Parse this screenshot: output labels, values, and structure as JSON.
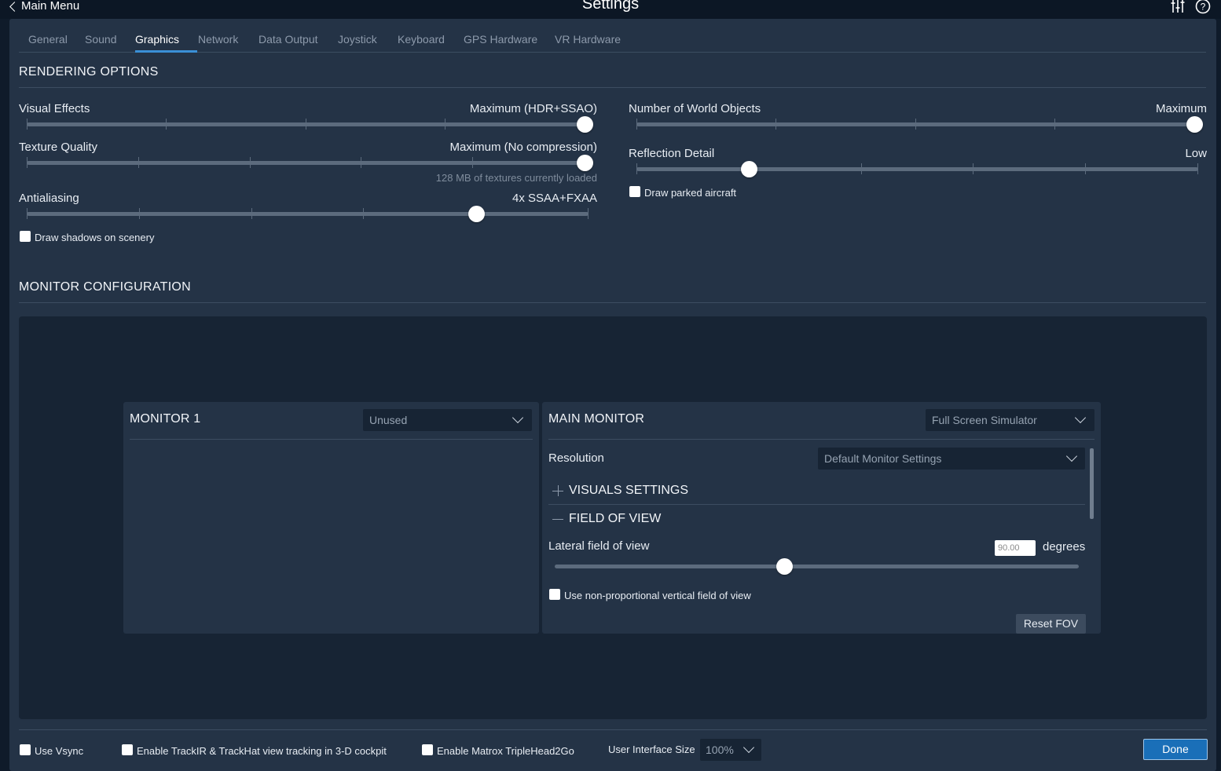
{
  "topbar": {
    "back_label": "Main Menu",
    "title": "Settings",
    "icons": [
      "sliders-icon",
      "help-icon"
    ]
  },
  "tabs": [
    {
      "label": "General"
    },
    {
      "label": "Sound"
    },
    {
      "label": "Graphics",
      "active": true
    },
    {
      "label": "Network"
    },
    {
      "label": "Data Output"
    },
    {
      "label": "Joystick"
    },
    {
      "label": "Keyboard"
    },
    {
      "label": "GPS Hardware"
    },
    {
      "label": "VR Hardware"
    }
  ],
  "rendering": {
    "title": "RENDERING OPTIONS",
    "visual_effects": {
      "label": "Visual Effects",
      "value": "Maximum (HDR+SSAO)",
      "level": 1.0,
      "steps": 5
    },
    "texture_quality": {
      "label": "Texture Quality",
      "value": "Maximum (No compression)",
      "level": 1.0,
      "steps": 6,
      "note": "128 MB of textures currently loaded"
    },
    "antialiasing": {
      "label": "Antialiasing",
      "value": "4x SSAA+FXAA",
      "level": 0.8,
      "steps": 6
    },
    "draw_shadows": {
      "label": "Draw shadows on scenery",
      "checked": false
    },
    "world_objects": {
      "label": "Number of World Objects",
      "value": "Maximum",
      "level": 1.0,
      "steps": 5
    },
    "reflection_detail": {
      "label": "Reflection Detail",
      "value": "Low",
      "level": 0.2,
      "steps": 6
    },
    "draw_parked": {
      "label": "Draw parked aircraft",
      "checked": false
    }
  },
  "monitor": {
    "title": "MONITOR CONFIGURATION",
    "monitor1": {
      "title": "MONITOR 1",
      "mode": "Unused"
    },
    "main": {
      "title": "MAIN MONITOR",
      "mode": "Full Screen Simulator",
      "resolution_label": "Resolution",
      "resolution_value": "Default Monitor Settings",
      "visuals_settings": "VISUALS SETTINGS",
      "field_of_view": "FIELD OF VIEW",
      "lateral_label": "Lateral field of view",
      "lateral_value": "90.00",
      "degrees": "degrees",
      "lateral_level": 0.4375,
      "nonprop_label": "Use non-proportional vertical field of view",
      "nonprop_checked": false,
      "reset_fov": "Reset FOV"
    }
  },
  "bottom": {
    "vsync": "Use Vsync",
    "trackir": "Enable TrackIR & TrackHat view tracking in 3-D cockpit",
    "matrox": "Enable Matrox TripleHead2Go",
    "ui_size_label": "User Interface Size",
    "ui_size_value": "100%",
    "done": "Done"
  },
  "colors": {
    "background": "#0f1b2a",
    "panel": "#243346",
    "accent": "#3a8fd6",
    "done_button": "#1a6fb8"
  }
}
